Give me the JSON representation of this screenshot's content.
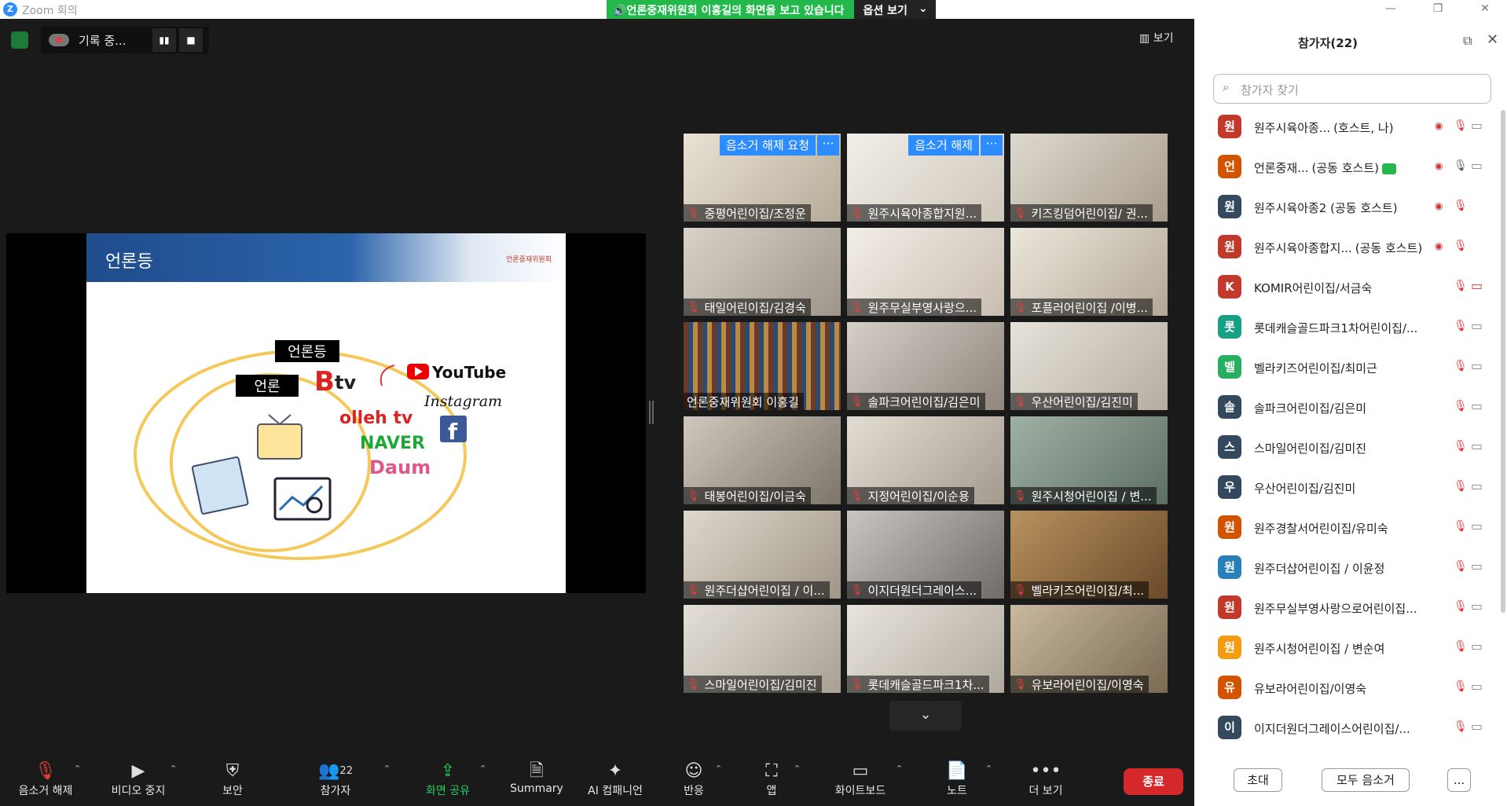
{
  "window": {
    "app_title": "Zoom 회의",
    "app_icon": "Z"
  },
  "share_banner": {
    "message": "언론중재위원회 이홍길의 화면을 보고 있습니다",
    "options_label": "옵션 보기"
  },
  "recording": {
    "label": "기록 중..."
  },
  "view_label": "보기",
  "slide": {
    "title": "언론등",
    "label_outer": "언론등",
    "label_inner": "언론",
    "brand_btv": "tv",
    "brand_olleh": "olleh tv",
    "brand_youtube": "YouTube",
    "brand_instagram": "Instagram",
    "brand_facebook": "f",
    "brand_naver": "NAVER",
    "brand_daum": "Daum",
    "logo_text": "언론중재위원회"
  },
  "tiles": [
    {
      "name": "중평어린이집/조정운",
      "badge": "음소거 해제 요청"
    },
    {
      "name": "원주시육아종합지원...",
      "badge": "음소거 해제"
    },
    {
      "name": "키즈킹덤어린이집/ 권..."
    },
    {
      "name": "태일어린이집/김경숙"
    },
    {
      "name": "원주무실부영사랑으..."
    },
    {
      "name": "포플러어린이집 /이병..."
    },
    {
      "name": "언론중재위원회 이홍길"
    },
    {
      "name": "솔파크어린이집/김은미"
    },
    {
      "name": "우산어린이집/김진미"
    },
    {
      "name": "태봉어린이집/이금숙"
    },
    {
      "name": "지정어린이집/이순용"
    },
    {
      "name": "원주시청어린이집 / 변..."
    },
    {
      "name": "원주더샵어린이집 / 이..."
    },
    {
      "name": "이지더원더그레이스..."
    },
    {
      "name": "벨라키즈어린이집/최..."
    },
    {
      "name": "스마일어린이집/김미진"
    },
    {
      "name": "롯데캐슬골드파크1차..."
    },
    {
      "name": "유보라어린이집/이영숙"
    }
  ],
  "toolbar": {
    "unmute": "음소거 해제",
    "video": "비디오 중지",
    "security": "보안",
    "participants": "참가자",
    "participants_count": "22",
    "share": "화면 공유",
    "summary": "Summary",
    "ai": "AI 컴패니언",
    "reactions": "반응",
    "apps": "앱",
    "whiteboard": "화이트보드",
    "notes": "노트",
    "more": "더 보기",
    "end": "종료"
  },
  "panel": {
    "title": "참가자(22)",
    "search_placeholder": "참가자 찾기",
    "invite": "초대",
    "mute_all": "모두 음소거",
    "more": "..."
  },
  "participants": [
    {
      "initial": "원",
      "color": "#c0392b",
      "name": "원주시육아종...",
      "role": "(호스트, 나)",
      "mic": "muted",
      "cam": "on",
      "recording": true
    },
    {
      "initial": "언",
      "color": "#d35400",
      "name": "언론중재...",
      "role": "(공동 호스트)",
      "mic": "on",
      "cam": "on",
      "recording": true,
      "sharing": true
    },
    {
      "initial": "원",
      "color": "#34495e",
      "name": "원주시육아종2 (공동 호스트)",
      "role": "",
      "mic": "muted",
      "cam": "none",
      "recording": true
    },
    {
      "initial": "원",
      "color": "#c0392b",
      "name": "원주시육아종합지...",
      "role": "(공동 호스트)",
      "mic": "muted",
      "cam": "none",
      "recording": true
    },
    {
      "initial": "K",
      "color": "#c0392b",
      "name": "KOMIR어린이집/서금숙",
      "role": "",
      "mic": "muted",
      "cam": "off"
    },
    {
      "initial": "롯",
      "color": "#16a085",
      "name": "롯데캐슬골드파크1차어린이집/...",
      "role": "",
      "mic": "muted",
      "cam": "on"
    },
    {
      "initial": "벨",
      "color": "#27ae60",
      "name": "벨라키즈어린이집/최미근",
      "role": "",
      "mic": "muted",
      "cam": "on"
    },
    {
      "initial": "솔",
      "color": "#34495e",
      "name": "솔파크어린이집/김은미",
      "role": "",
      "mic": "muted",
      "cam": "on"
    },
    {
      "initial": "스",
      "color": "#34495e",
      "name": "스마일어린이집/김미진",
      "role": "",
      "mic": "muted",
      "cam": "on"
    },
    {
      "initial": "우",
      "color": "#34495e",
      "name": "우산어린이집/김진미",
      "role": "",
      "mic": "muted",
      "cam": "on"
    },
    {
      "initial": "원",
      "color": "#d35400",
      "name": "원주경찰서어린이집/유미숙",
      "role": "",
      "mic": "muted",
      "cam": "on"
    },
    {
      "initial": "원",
      "color": "#2980b9",
      "name": "원주더샵어린이집 / 이윤정",
      "role": "",
      "mic": "muted",
      "cam": "on"
    },
    {
      "initial": "원",
      "color": "#c0392b",
      "name": "원주무실부영사랑으로어린이집...",
      "role": "",
      "mic": "muted",
      "cam": "on"
    },
    {
      "initial": "원",
      "color": "#f39c12",
      "name": "원주시청어린이집 / 변순여",
      "role": "",
      "mic": "muted",
      "cam": "on"
    },
    {
      "initial": "유",
      "color": "#d35400",
      "name": "유보라어린이집/이영숙",
      "role": "",
      "mic": "muted",
      "cam": "on"
    },
    {
      "initial": "이",
      "color": "#34495e",
      "name": "이지더원더그레이스어린이집/...",
      "role": "",
      "mic": "muted",
      "cam": "on"
    }
  ]
}
